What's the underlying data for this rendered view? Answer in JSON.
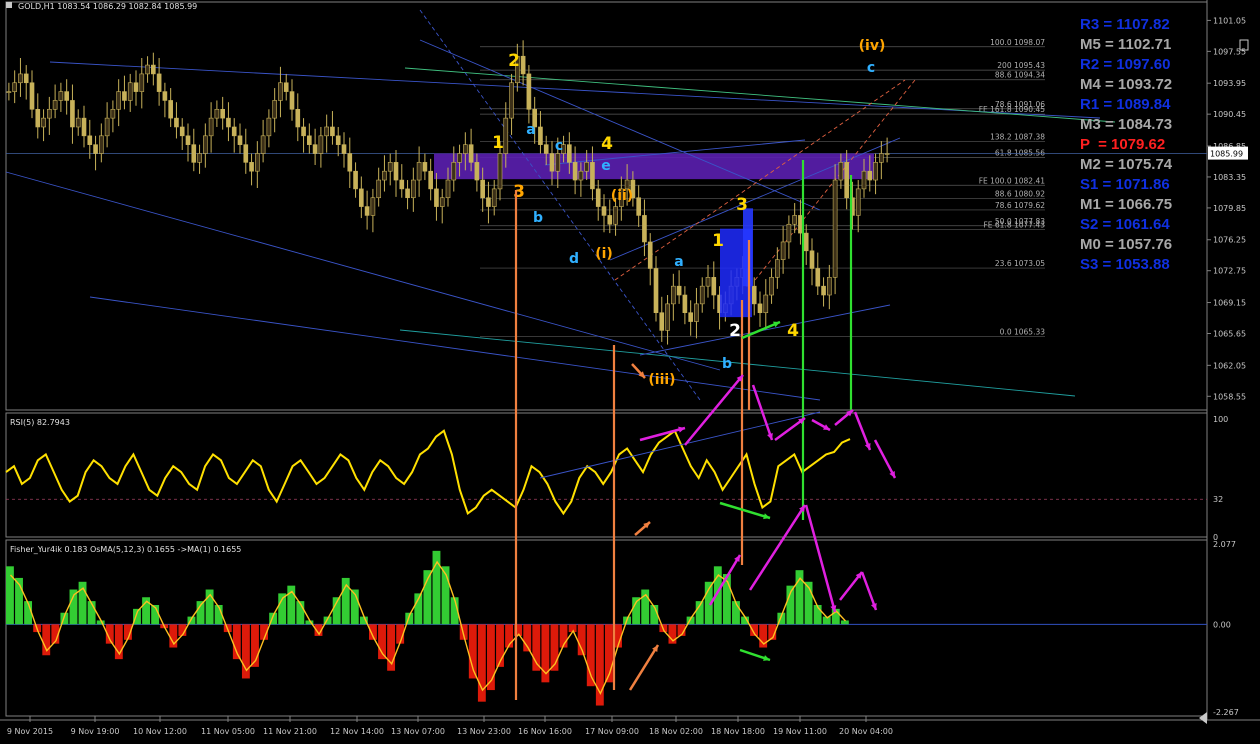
{
  "window": {
    "title": "GOLD,H1  1083.54 1086.29 1082.84 1085.99"
  },
  "colors": {
    "bull": "#c8b25a",
    "bear": "#c8b25a",
    "bg": "#000000",
    "grid": "#2a2a2a",
    "pivotBlue": "#1030e0",
    "pivotGray": "#a8a8a8",
    "pivotRed": "#ff2020"
  },
  "pivots": [
    {
      "text": "R3 = 1107.82",
      "color": "#1030e0"
    },
    {
      "text": "M5 = 1102.71",
      "color": "#a8a8a8"
    },
    {
      "text": "R2 = 1097.60",
      "color": "#1030e0"
    },
    {
      "text": "M4 = 1093.72",
      "color": "#a8a8a8"
    },
    {
      "text": "R1 = 1089.84",
      "color": "#1030e0"
    },
    {
      "text": "M3 = 1084.73",
      "color": "#a8a8a8"
    },
    {
      "text": "P  = 1079.62",
      "color": "#ff2020"
    },
    {
      "text": "M2 = 1075.74",
      "color": "#a8a8a8"
    },
    {
      "text": "S1 = 1071.86",
      "color": "#1030e0"
    },
    {
      "text": "M1 = 1066.75",
      "color": "#a8a8a8"
    },
    {
      "text": "S2 = 1061.64",
      "color": "#1030e0"
    },
    {
      "text": "M0 = 1057.76",
      "color": "#a8a8a8"
    },
    {
      "text": "S3 = 1053.88",
      "color": "#1030e0"
    }
  ],
  "chart_data": [
    {
      "type": "candlestick",
      "title": "GOLD,H1",
      "ohlc_header": "1083.54 1086.29 1082.84 1085.99",
      "ylim": [
        1057.0,
        1102.0
      ],
      "y_ticks": [
        "1101.05",
        "1097.55",
        "1093.95",
        "1090.45",
        "1086.85",
        "1083.35",
        "1079.85",
        "1076.25",
        "1072.75",
        "1069.15",
        "1065.65",
        "1062.05",
        "1058.55"
      ],
      "last_price": "1085.99",
      "x_ticks": [
        "9 Nov 2015",
        "9 Nov 19:00",
        "10 Nov 12:00",
        "11 Nov 05:00",
        "11 Nov 21:00",
        "12 Nov 14:00",
        "13 Nov 07:00",
        "13 Nov 23:00",
        "16 Nov 16:00",
        "17 Nov 09:00",
        "18 Nov 02:00",
        "18 Nov 18:00",
        "19 Nov 11:00",
        "20 Nov 04:00"
      ],
      "close_path": [
        1093,
        1094,
        1095,
        1094,
        1091,
        1089,
        1090,
        1091,
        1092,
        1093,
        1092,
        1089,
        1090,
        1088,
        1087,
        1086,
        1088,
        1090,
        1091,
        1093,
        1092,
        1094,
        1093,
        1095,
        1096,
        1095,
        1093,
        1092,
        1090,
        1089,
        1088,
        1087,
        1085,
        1086,
        1088,
        1090,
        1091,
        1090,
        1089,
        1088,
        1087,
        1085,
        1084,
        1086,
        1088,
        1090,
        1092,
        1094,
        1093,
        1091,
        1089,
        1088,
        1087,
        1086,
        1088,
        1089,
        1088,
        1087,
        1086,
        1084,
        1082,
        1080,
        1079,
        1081,
        1083,
        1084,
        1085,
        1083,
        1082,
        1081,
        1083,
        1085,
        1084,
        1082,
        1080,
        1081,
        1083,
        1085,
        1086,
        1087,
        1085,
        1083,
        1081,
        1080,
        1082,
        1086,
        1090,
        1094,
        1097,
        1095,
        1091,
        1089,
        1087,
        1086,
        1084,
        1086,
        1087,
        1085,
        1083,
        1084,
        1085,
        1082,
        1080,
        1079,
        1078,
        1080,
        1082,
        1083,
        1081,
        1079,
        1076,
        1073,
        1068,
        1066,
        1069,
        1071,
        1070,
        1068,
        1067,
        1069,
        1071,
        1072,
        1070,
        1068,
        1069,
        1071,
        1072,
        1073,
        1071,
        1069,
        1068,
        1070,
        1072,
        1074,
        1076,
        1078,
        1079,
        1077,
        1075,
        1073,
        1071,
        1070,
        1072,
        1083,
        1085,
        1081,
        1079,
        1082,
        1084,
        1083,
        1085,
        1086,
        1086
      ],
      "fib_levels": [
        {
          "label": "100.0  1098.07",
          "value": 1098.07
        },
        {
          "label": "200  1095.43",
          "value": 1095.43
        },
        {
          "label": "88.6  1094.34",
          "value": 1094.34
        },
        {
          "label": "78.6  1091.06",
          "value": 1091.06
        },
        {
          "label": "FE 161.8  1090.45",
          "value": 1090.45
        },
        {
          "label": "138.2  1087.38",
          "value": 1087.38
        },
        {
          "label": "61.8  1085.56",
          "value": 1085.56
        },
        {
          "label": "FE 100.0  1082.41",
          "value": 1082.41
        },
        {
          "label": "88.6  1080.92",
          "value": 1080.92
        },
        {
          "label": "78.6  1079.62",
          "value": 1079.62
        },
        {
          "label": "50.0  1077.83",
          "value": 1077.83
        },
        {
          "label": "FE 61.8  1077.43",
          "value": 1077.43
        },
        {
          "label": "23.6  1073.05",
          "value": 1073.05
        },
        {
          "label": "0.0  1065.33",
          "value": 1065.33
        }
      ],
      "wave_labels": [
        {
          "text": "2",
          "color": "#ffd700"
        },
        {
          "text": "1",
          "color": "#ffd700"
        },
        {
          "text": "3",
          "color": "#ffa500"
        },
        {
          "text": "a",
          "color": "#30b0ff"
        },
        {
          "text": "b",
          "color": "#30b0ff"
        },
        {
          "text": "c",
          "color": "#30b0ff"
        },
        {
          "text": "d",
          "color": "#30b0ff"
        },
        {
          "text": "e",
          "color": "#30b0ff"
        },
        {
          "text": "4",
          "color": "#ffd700"
        },
        {
          "text": "(ii)",
          "color": "#ffa500"
        },
        {
          "text": "(i)",
          "color": "#ffa500"
        },
        {
          "text": "(iii)",
          "color": "#ffa500"
        },
        {
          "text": "a",
          "color": "#30b0ff"
        },
        {
          "text": "b",
          "color": "#30b0ff"
        },
        {
          "text": "1",
          "color": "#ffd700"
        },
        {
          "text": "3",
          "color": "#ffd700"
        },
        {
          "text": "2",
          "color": "#ffffff"
        },
        {
          "text": "4",
          "color": "#ffd700"
        },
        {
          "text": "(iv)",
          "color": "#ffa500"
        },
        {
          "text": "c",
          "color": "#30b0ff"
        }
      ]
    },
    {
      "type": "line",
      "title": "RSI(5) 82.7943",
      "ylim": [
        0,
        100
      ],
      "y_ticks": [
        "100",
        "32",
        "0"
      ],
      "levels": [
        32
      ],
      "values": [
        55,
        60,
        45,
        50,
        65,
        70,
        55,
        40,
        30,
        35,
        55,
        65,
        60,
        50,
        45,
        60,
        70,
        55,
        40,
        35,
        50,
        60,
        55,
        45,
        40,
        60,
        70,
        65,
        50,
        45,
        55,
        65,
        60,
        40,
        30,
        45,
        60,
        65,
        55,
        45,
        50,
        60,
        70,
        65,
        50,
        40,
        55,
        65,
        60,
        50,
        45,
        55,
        70,
        75,
        85,
        90,
        70,
        40,
        20,
        25,
        35,
        40,
        35,
        30,
        25,
        40,
        60,
        55,
        45,
        30,
        20,
        30,
        50,
        60,
        55,
        45,
        55,
        70,
        75,
        65,
        55,
        70,
        80,
        85,
        90,
        75,
        60,
        50,
        65,
        55,
        40,
        50,
        60,
        70,
        45,
        25,
        30,
        60,
        65,
        70,
        55,
        60,
        65,
        70,
        72,
        80,
        83
      ]
    },
    {
      "type": "histogram+line",
      "title": "Fisher_Yur4ik 0.183  OsMA(5,12,3) 0.1655  ->MA(1) 0.1655",
      "ylim": [
        -2.267,
        2.077
      ],
      "y_ticks": [
        "2.077",
        "0.00",
        "-2.267"
      ],
      "values": [
        1.5,
        1.2,
        0.6,
        -0.2,
        -0.8,
        -0.5,
        0.3,
        0.9,
        1.1,
        0.6,
        0.1,
        -0.5,
        -0.9,
        -0.4,
        0.4,
        0.7,
        0.5,
        -0.1,
        -0.6,
        -0.3,
        0.2,
        0.6,
        0.9,
        0.5,
        -0.2,
        -0.9,
        -1.4,
        -1.1,
        -0.4,
        0.3,
        0.8,
        1.0,
        0.6,
        0.1,
        -0.3,
        0.2,
        0.7,
        1.2,
        0.9,
        0.2,
        -0.4,
        -0.9,
        -1.2,
        -0.5,
        0.3,
        0.8,
        1.4,
        1.9,
        1.5,
        0.7,
        -0.4,
        -1.4,
        -2.0,
        -1.7,
        -1.1,
        -0.6,
        -0.3,
        -0.7,
        -1.2,
        -1.5,
        -1.2,
        -0.6,
        -0.2,
        -0.8,
        -1.6,
        -2.1,
        -1.5,
        -0.6,
        0.2,
        0.7,
        0.9,
        0.5,
        -0.2,
        -0.5,
        -0.3,
        0.2,
        0.6,
        1.1,
        1.5,
        1.3,
        0.6,
        0.2,
        -0.3,
        -0.6,
        -0.4,
        0.3,
        1.0,
        1.4,
        1.1,
        0.5,
        0.2,
        0.4,
        0.1
      ]
    }
  ]
}
